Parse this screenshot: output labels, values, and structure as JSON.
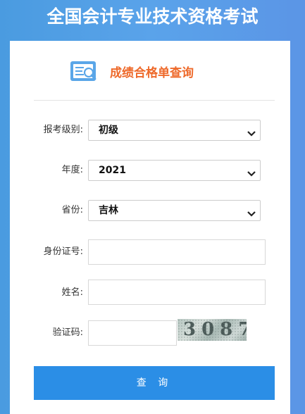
{
  "page": {
    "title": "全国会计专业技术资格考试"
  },
  "header": {
    "icon": "document-search-icon",
    "title": "成绩合格单查询"
  },
  "form": {
    "level": {
      "label": "报考级别:",
      "value": "初级"
    },
    "year": {
      "label": "年度:",
      "value": "2021"
    },
    "province": {
      "label": "省份:",
      "value": "吉林"
    },
    "id_number": {
      "label": "身份证号:",
      "value": ""
    },
    "name": {
      "label": "姓名:",
      "value": ""
    },
    "captcha": {
      "label": "验证码:",
      "value": "",
      "image_text": "3087"
    },
    "submit_label": "查 询"
  },
  "colors": {
    "accent": "#2b8ee6",
    "header_title": "#ee6a2b"
  }
}
